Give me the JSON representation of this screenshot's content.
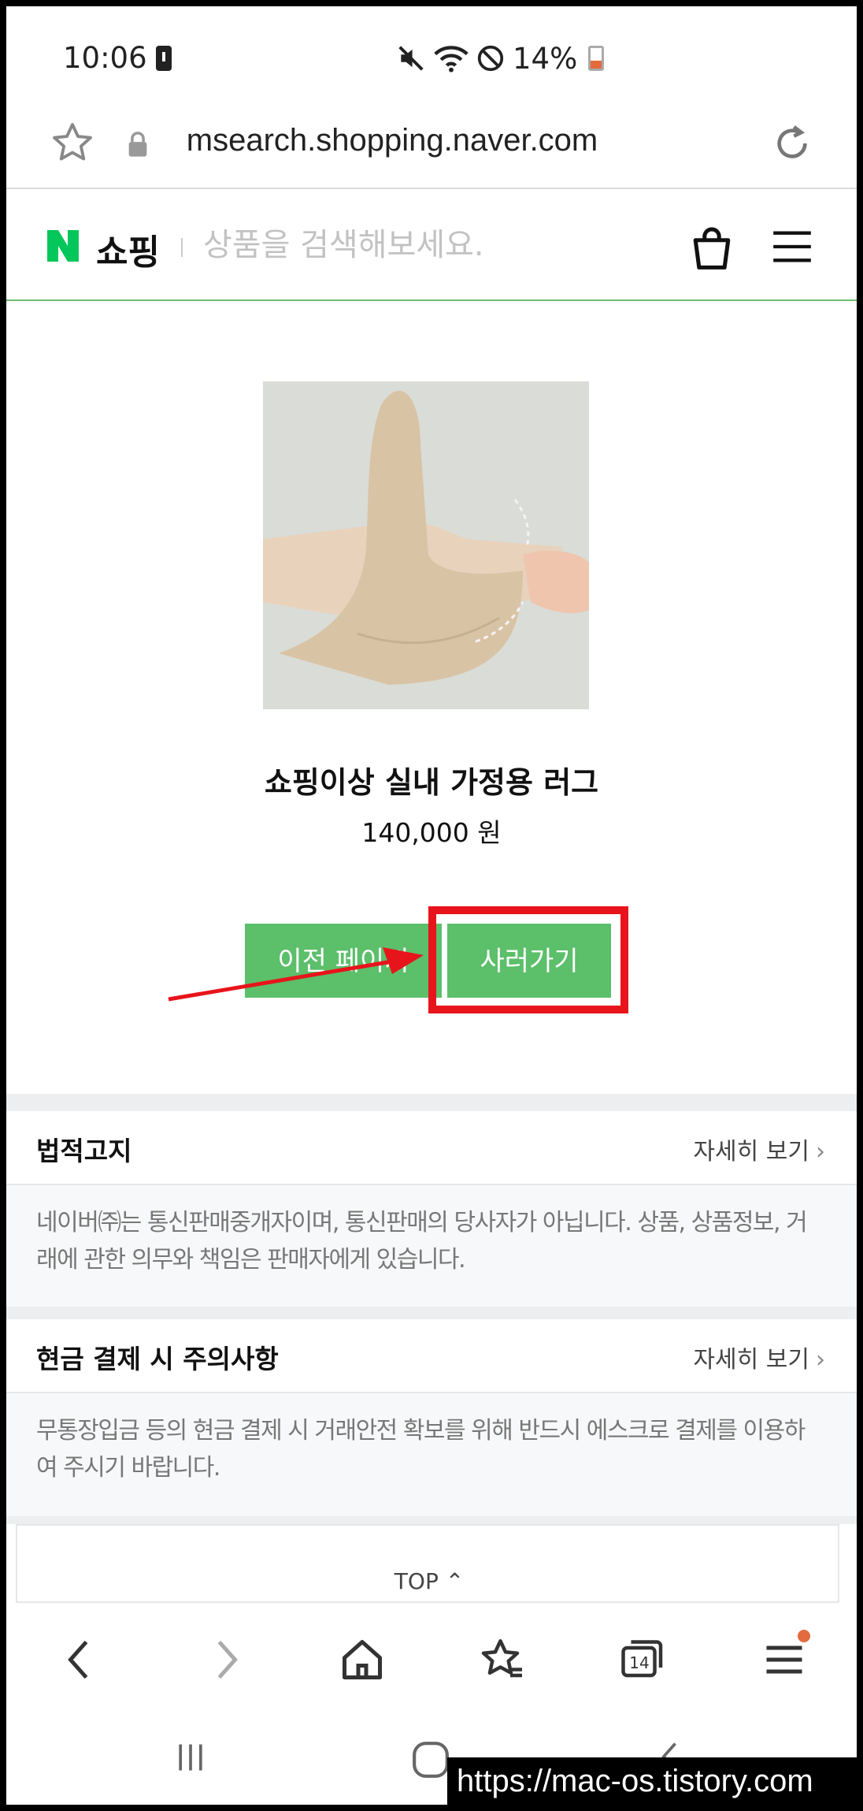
{
  "status_bar": {
    "time": "10:06",
    "battery": "14%"
  },
  "browser": {
    "url": "msearch.shopping.naver.com",
    "tab_count": "14"
  },
  "header": {
    "logo_letter": "N",
    "brand": "쇼핑",
    "search_placeholder": "상품을 검색해보세요."
  },
  "product": {
    "title": "쇼핑이상 실내 가정용 러그",
    "price": "140,000 원",
    "prev_button": "이전 페이지",
    "buy_button": "사러가기"
  },
  "sections": [
    {
      "title": "법적고지",
      "more": "자세히 보기",
      "body": "네이버㈜는 통신판매중개자이며, 통신판매의 당사자가 아닙니다. 상품, 상품정보, 거래에 관한 의무와 책임은 판매자에게 있습니다."
    },
    {
      "title": "현금 결제 시 주의사항",
      "more": "자세히 보기",
      "body": "무통장입금 등의 현금 결제 시 거래안전 확보를 위해 반드시 에스크로 결제를 이용하여 주시기 바랍니다."
    }
  ],
  "top_link": "TOP",
  "watermark": "https://mac-os.tistory.com",
  "colors": {
    "naver_green": "#5cbf6a",
    "highlight_red": "#e8141b",
    "notification_dot": "#e36b3d"
  }
}
